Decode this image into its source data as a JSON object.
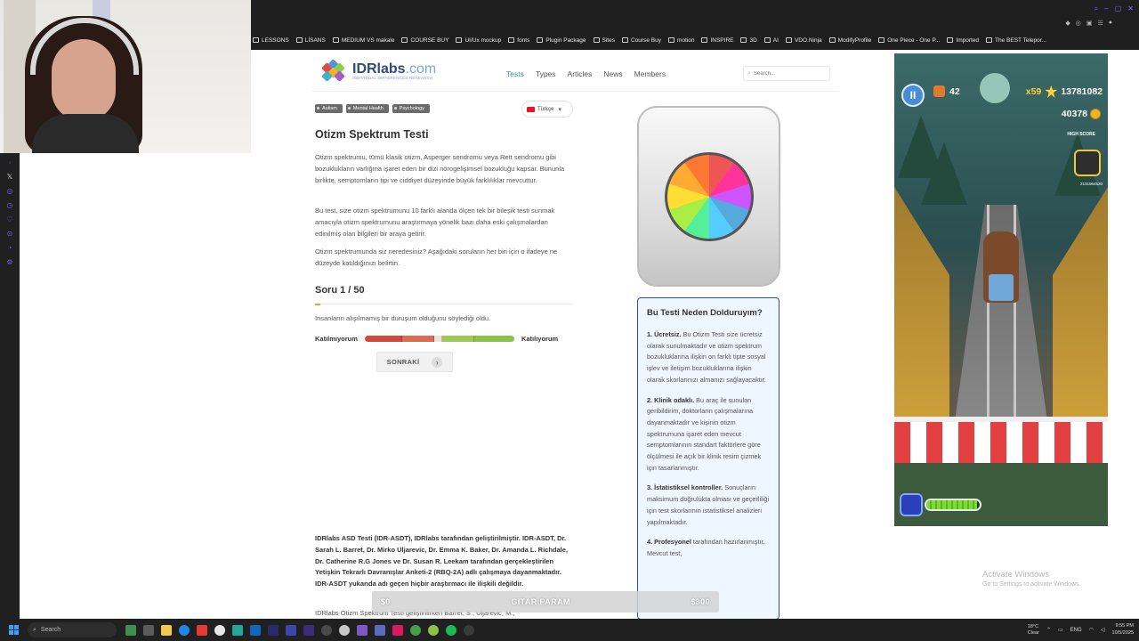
{
  "bookmarks": [
    "LESSONS",
    "LİSANS",
    "MEDIUM VS makale",
    "COURSE BUY",
    "UI/Ux mockup",
    "fonts",
    "Plugin Package",
    "Sites",
    "Course Buy",
    "motion",
    "INSPIRE",
    "3D",
    "AI",
    "VDO.Ninja",
    "ModifyProfile",
    "One Piece - One P...",
    "Imported",
    "The BEST Telepor..."
  ],
  "site": {
    "logo": {
      "brand": "IDRlabs",
      "tld": ".com",
      "tagline": "INDIVIDUAL DIFFERENCES RESEARCH"
    },
    "nav": [
      "Tests",
      "Types",
      "Articles",
      "News",
      "Members"
    ],
    "search_placeholder": "Search...",
    "tags": [
      "Autism",
      "Mental Health",
      "Psychology"
    ],
    "language": "Türkçe",
    "title": "Otizm Spektrum Testi",
    "paragraphs": [
      "Otizm spektrumu, tümü klasik otizm, Asperger sendromu veya Rett sendromu gibi bozuklukların varlığına işaret eden bir dizi nörogelişimsel bozukluğu kapsar. Bununla birlikte, semptomların tipi ve ciddiyet düzeyinde büyük farklılıklar mevcuttur.",
      "Bu test, size otizm spektrumunu 10 farklı alanda ölçen tek bir bileşik testi sunmak amacıyla otizm spektrumunu araştırmaya yönelik bazı daha eski çalışmalardan edinilmiş olan bilgileri bir araya getirir.",
      "Otizm spektrumunda siz neredesiniz? Aşağıdaki soruların her biri için o ifadeye ne düzeyde katıldığınızı belirtin."
    ],
    "question_count": "Soru 1 / 50",
    "question_progress": 0.02,
    "question_text": "İnsanların alışılmamış bir duruşum olduğunu söylediği oldu.",
    "scale_left": "Katılmıyorum",
    "scale_right": "Katılıyorum",
    "next_button": "SONRAKİ",
    "bottom_bold": "IDRlabs ASD Testi (IDR-ASDT), IDRlabs tarafından geliştirilmiştir. IDR-ASDT, Dr. Sarah L. Barret, Dr. Mirko Uljarevic, Dr. Emma K. Baker, Dr. Amanda L. Richdale, Dr. Catherine R.G Jones ve Dr. Susan R. Leekam tarafından gerçekleştirilen Yetişkin Tekrarlı Davranışlar Anketi-2 (RBQ-2A) adlı çalışmaya dayanmaktadır. IDR-ASDT yukarıda adı geçen hiçbir araştırmacı ile ilişkili değildir.",
    "bottom_cut": "IDRlabs Otizm Spektrum Testi geliştirilirken Barret, S., Uljarevic, M.,",
    "why_title": "Bu Testi Neden Dolduruyım?",
    "why_items": [
      {
        "head": "1. Ücretsiz.",
        "body": " Bu Otizm Testi size ücretsiz olarak sunulmaktadır ve otizm spektrum bozukluklarına ilişkin on farklı tipte sosyal işlev ve iletişim bozukluklarına ilişkin olarak skorlarınızı almanızı sağlayacaktır."
      },
      {
        "head": "2. Klinik odaklı.",
        "body": " Bu araç ile sunulan geribildirim, doktorların çalışmalarına dayanmaktadır ve kişinin otizm spektrumuna işaret eden mevcut semptomlarının standart faktörlere göre ölçülmesi ile açık bir klinik resim çizmek için tasarlanmıştır."
      },
      {
        "head": "3. İstatistiksel kontroller.",
        "body": " Sonuçların maksimum doğrulukta olması ve geçerliliği için test skorlarının istatistiksel analizleri yapılmaktadır."
      },
      {
        "head": "4. Profesyonel",
        "body": " tarafından hazırlanmıştır. Mevcut test,"
      }
    ]
  },
  "game": {
    "keys": "42",
    "multiplier": "x59",
    "score": "13781082",
    "coins": "40378",
    "high_score_label": "HIGH SCORE",
    "high_score_value": "2131964520",
    "power_level": 0.95
  },
  "stream_bar": {
    "left": "$0",
    "center": "GITAR PARAM",
    "right": "$300"
  },
  "activate": {
    "line1": "Activate Windows",
    "line2": "Go to Settings to activate Windows."
  },
  "taskbar": {
    "search": "Search",
    "weather_temp": "18°C",
    "weather_desc": "Clear",
    "lang": "ENG",
    "time": "9:55 PM",
    "date": "10/5/2025"
  }
}
